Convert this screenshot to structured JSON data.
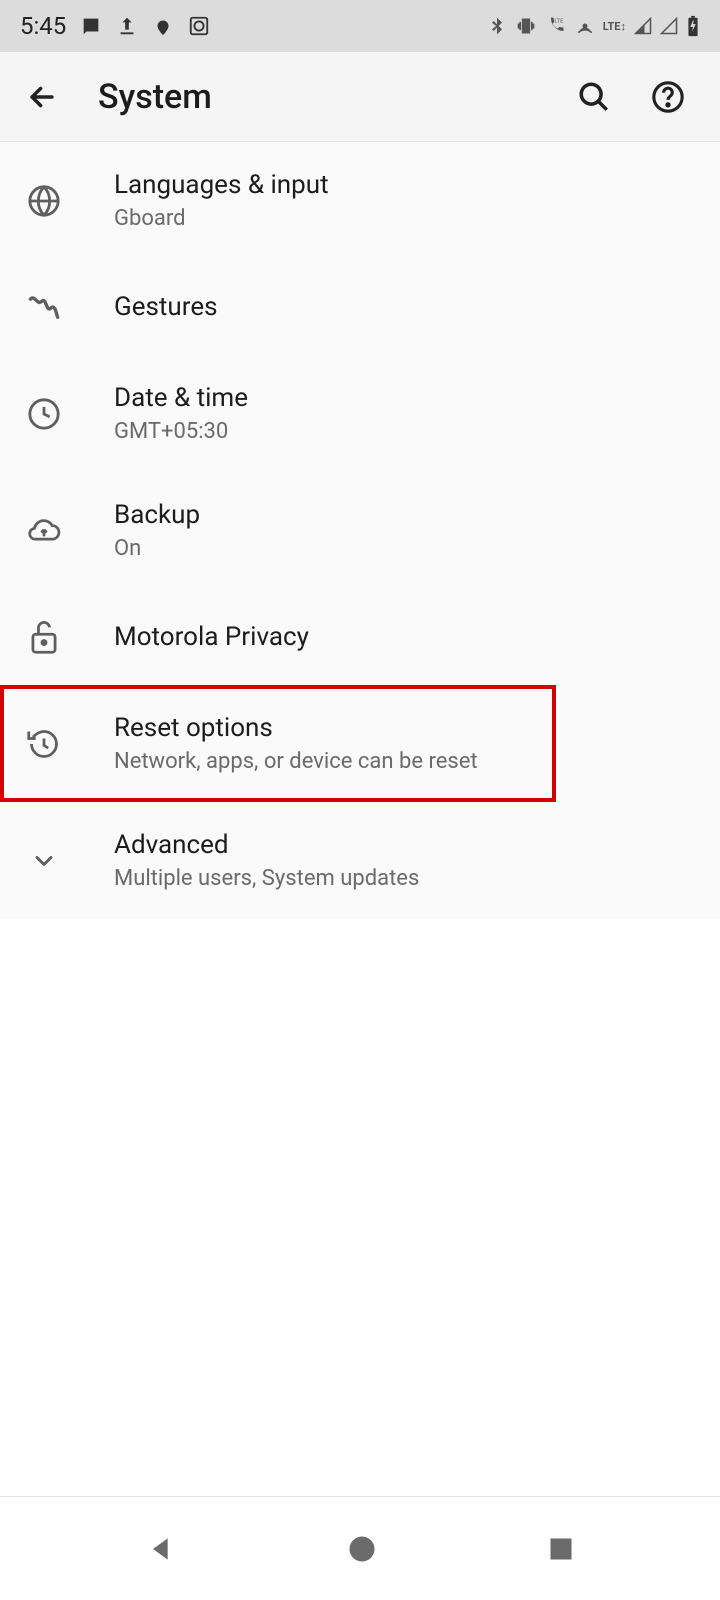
{
  "status_bar": {
    "time": "5:45"
  },
  "app_bar": {
    "title": "System"
  },
  "items": [
    {
      "title": "Languages & input",
      "subtitle": "Gboard"
    },
    {
      "title": "Gestures",
      "subtitle": ""
    },
    {
      "title": "Date & time",
      "subtitle": "GMT+05:30"
    },
    {
      "title": "Backup",
      "subtitle": "On"
    },
    {
      "title": "Motorola Privacy",
      "subtitle": ""
    },
    {
      "title": "Reset options",
      "subtitle": "Network, apps, or device can be reset"
    },
    {
      "title": "Advanced",
      "subtitle": "Multiple users, System updates"
    }
  ]
}
